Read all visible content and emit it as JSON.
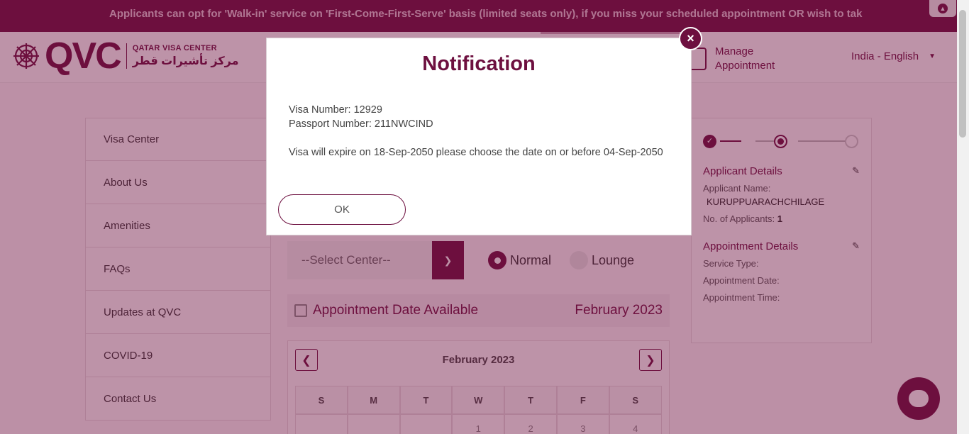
{
  "marquee": {
    "text": "Applicants can opt for 'Walk-in' service on 'First-Come-First-Serve' basis (limited seats only), if you miss your scheduled appointment OR wish to take t"
  },
  "header": {
    "logo_text": "QVC",
    "logo_en": "QATAR VISA CENTER",
    "logo_ar": "مركز تأشيرات قطر",
    "manage_label": "Manage Appointment",
    "language": "India - English"
  },
  "sidebar": {
    "items": [
      {
        "label": "Visa Center"
      },
      {
        "label": "About Us"
      },
      {
        "label": "Amenities"
      },
      {
        "label": "FAQs"
      },
      {
        "label": "Updates at QVC"
      },
      {
        "label": "COVID-19"
      },
      {
        "label": "Contact Us"
      }
    ]
  },
  "center_select": {
    "placeholder": "--Select Center--"
  },
  "service_type": {
    "normal": "Normal",
    "lounge": "Lounge",
    "selected": "Normal"
  },
  "availability": {
    "label": "Appointment Date Available",
    "month": "February 2023"
  },
  "calendar": {
    "title": "February  2023",
    "weekdays": [
      "S",
      "M",
      "T",
      "W",
      "T",
      "F",
      "S"
    ],
    "first_row": [
      "",
      "",
      "",
      "1",
      "2",
      "3",
      "4"
    ]
  },
  "summary": {
    "applicant_title": "Applicant Details",
    "applicant_name_label": "Applicant Name:",
    "applicant_name": "KURUPPUARACHCHILAGE",
    "num_applicants_label": "No. of Applicants:",
    "num_applicants": "1",
    "appointment_title": "Appointment Details",
    "service_type_label": "Service Type:",
    "appointment_date_label": "Appointment Date:",
    "appointment_time_label": "Appointment Time:"
  },
  "modal": {
    "title": "Notification",
    "visa_number": "Visa Number: 12929",
    "passport_number": "Passport Number: 211NWCIND",
    "message": "Visa will expire on 18-Sep-2050 please choose the date on or before 04-Sep-2050",
    "ok_label": "OK",
    "close_symbol": "×"
  },
  "colors": {
    "brand": "#6d0f3f",
    "overlay": "rgba(109,15,63,0.45)"
  },
  "icons": {
    "close": "close-icon",
    "chevron_down": "chevron-down-icon",
    "calendar": "calendar-icon",
    "pencil": "pencil-icon",
    "chat": "chat-icon"
  }
}
